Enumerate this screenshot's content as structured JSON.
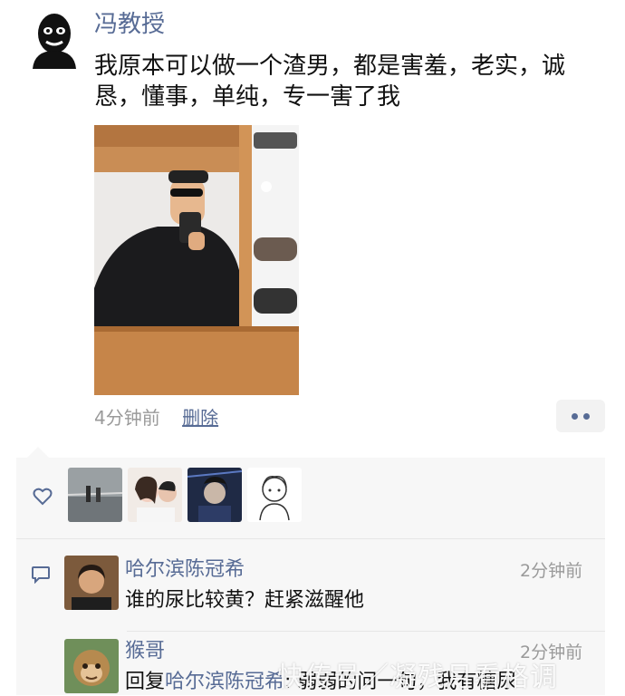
{
  "post": {
    "author": "冯教授",
    "text": "我原本可以做一个渣男，都是害羞，老实，诚恳，懂事，单纯，专一害了我",
    "time": "4分钟前",
    "delete_label": "删除"
  },
  "likes": {
    "icon": "heart-outline-icon",
    "avatars": [
      "avatar-1",
      "avatar-2",
      "avatar-3",
      "avatar-4"
    ]
  },
  "comments": [
    {
      "author": "哈尔滨陈冠希",
      "time": "2分钟前",
      "text": "谁的尿比较黄？赶紧滋醒他"
    },
    {
      "author": "猴哥",
      "time": "2分钟前",
      "reply_prefix": "回复",
      "reply_to": "哈尔滨陈冠希",
      "text": ": 弱弱的问一句，我有糖尿"
    }
  ],
  "watermark": "快传号／凝残月看格调",
  "colors": {
    "link": "#576b95",
    "muted": "#9a9a9a",
    "panel": "#f7f7f7"
  }
}
